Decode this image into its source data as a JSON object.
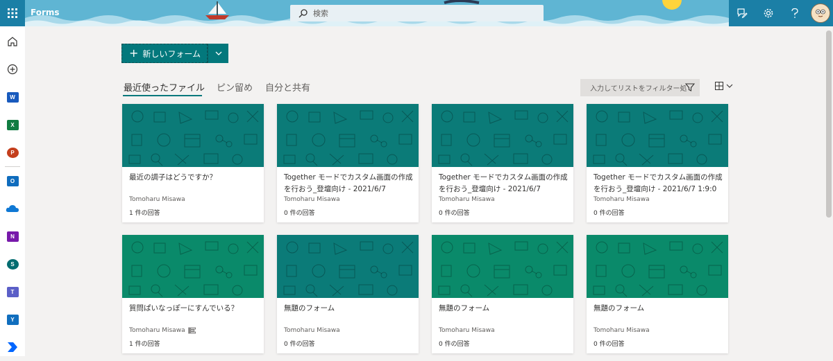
{
  "app": {
    "name": "Forms"
  },
  "search": {
    "placeholder": "検索"
  },
  "toolbar": {
    "new_form_label": "新しいフォーム"
  },
  "tabs": [
    {
      "label": "最近使ったファイル",
      "active": true
    },
    {
      "label": "ピン留め",
      "active": false
    },
    {
      "label": "自分と共有",
      "active": false
    }
  ],
  "filter": {
    "placeholder": "入力してリストをフィルター処"
  },
  "left_rail": [
    "home",
    "create",
    "word",
    "excel",
    "powerpoint",
    "outlook",
    "onedrive",
    "onenote",
    "sharepoint",
    "teams",
    "yammer",
    "power-automate"
  ],
  "colors": {
    "accent": "#03787c",
    "teal_banner": "#0b7b78",
    "green_banner": "#0a8a6a"
  },
  "cards": [
    {
      "title": "最近の調子はどうですか？",
      "owner": "Tomoharu Misawa",
      "responses": "1 件の回答",
      "banner": "teal"
    },
    {
      "title": "Together モードでカスタム画面の作成を行おう_登壇向け - 2021/6/7",
      "owner": "Tomoharu Misawa",
      "responses": "0 件の回答",
      "banner": "teal"
    },
    {
      "title": "Together モードでカスタム画面の作成を行おう_登壇向け - 2021/6/7",
      "owner": "Tomoharu Misawa",
      "responses": "0 件の回答",
      "banner": "teal"
    },
    {
      "title": "Together モードでカスタム画面の作成を行おう_登壇向け - 2021/6/7 1:9:0",
      "owner": "Tomoharu Misawa",
      "responses": "0 件の回答",
      "banner": "teal"
    },
    {
      "title": "質問ぱいなっぽーにすんでいる？",
      "owner": "Tomoharu Misawa",
      "responses": "1 件の回答",
      "banner": "green",
      "shared_icon": true
    },
    {
      "title": "無題のフォーム",
      "owner": "Tomoharu Misawa",
      "responses": "0 件の回答",
      "banner": "teal"
    },
    {
      "title": "無題のフォーム",
      "owner": "Tomoharu Misawa",
      "responses": "0 件の回答",
      "banner": "green"
    },
    {
      "title": "無題のフォーム",
      "owner": "Tomoharu Misawa",
      "responses": "0 件の回答",
      "banner": "green"
    }
  ]
}
